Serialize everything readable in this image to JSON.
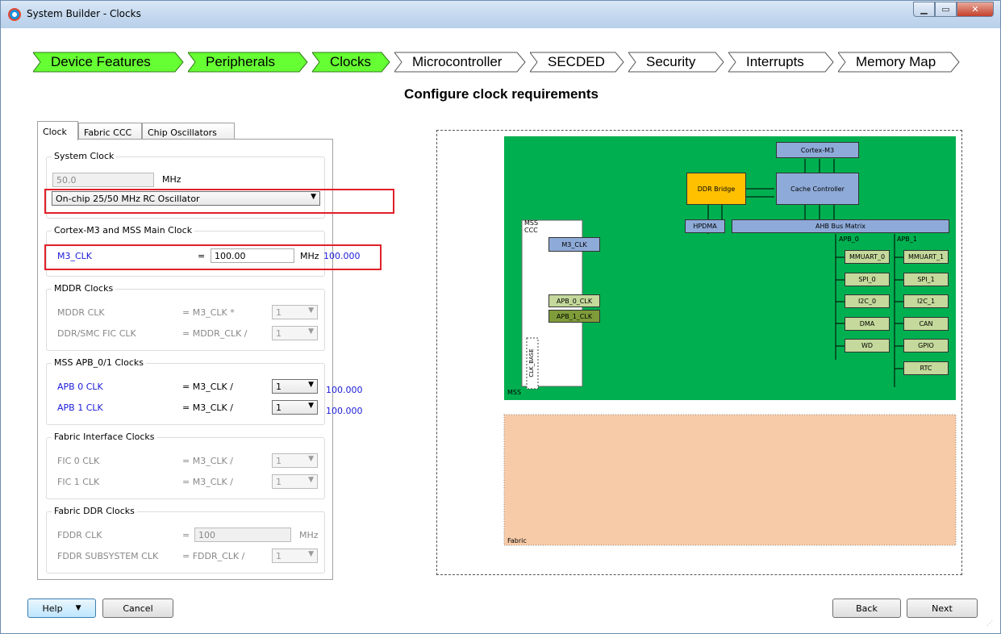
{
  "window": {
    "title": "System Builder - Clocks"
  },
  "steps": [
    {
      "label": "Device Features",
      "state": "done"
    },
    {
      "label": "Peripherals",
      "state": "done"
    },
    {
      "label": "Clocks",
      "state": "current"
    },
    {
      "label": "Microcontroller",
      "state": "todo"
    },
    {
      "label": "SECDED",
      "state": "todo"
    },
    {
      "label": "Security",
      "state": "todo"
    },
    {
      "label": "Interrupts",
      "state": "todo"
    },
    {
      "label": "Memory Map",
      "state": "todo"
    }
  ],
  "heading": "Configure clock requirements",
  "tabs": [
    "Clock",
    "Fabric CCC",
    "Chip Oscillators"
  ],
  "system_clock": {
    "group_label": "System Clock",
    "freq_value": "50.0",
    "unit": "MHz",
    "source": "On-chip 25/50 MHz RC Oscillator"
  },
  "main_clock": {
    "group_label": "Cortex-M3 and MSS Main Clock",
    "name": "M3_CLK",
    "equals": "=",
    "value": "100.00",
    "unit": "MHz",
    "actual": "100.000"
  },
  "mddr": {
    "group_label": "MDDR Clocks",
    "rows": [
      {
        "name": "MDDR  CLK",
        "formula": "= M3_CLK *",
        "ratio": "1"
      },
      {
        "name": "DDR/SMC  FIC  CLK",
        "formula": "= MDDR_CLK /",
        "ratio": "1"
      }
    ]
  },
  "apb": {
    "group_label": "MSS APB_0/1 Clocks",
    "rows": [
      {
        "name": "APB  0  CLK",
        "formula": "= M3_CLK /",
        "ratio": "1",
        "actual": "100.000"
      },
      {
        "name": "APB  1  CLK",
        "formula": "= M3_CLK /",
        "ratio": "1",
        "actual": "100.000"
      }
    ]
  },
  "fic": {
    "group_label": "Fabric Interface Clocks",
    "rows": [
      {
        "name": "FIC  0  CLK",
        "formula": "= M3_CLK /",
        "ratio": "1"
      },
      {
        "name": "FIC  1  CLK",
        "formula": "= M3_CLK /",
        "ratio": "1"
      }
    ]
  },
  "fddr": {
    "group_label": "Fabric DDR Clocks",
    "clk_name": "FDDR  CLK",
    "clk_equals": "=",
    "clk_value": "100",
    "clk_unit": "MHz",
    "sub_name": "FDDR  SUBSYSTEM  CLK",
    "sub_formula": "= FDDR_CLK /",
    "sub_ratio": "1"
  },
  "diagram": {
    "cortex": "Cortex-M3",
    "ddr_bridge": "DDR Bridge",
    "cache": "Cache Controller",
    "hpdma": "HPDMA",
    "ahb": "AHB Bus Matrix",
    "mss_ccc": "MSS  CCC",
    "m3clk": "M3_CLK",
    "apb0clk": "APB_0_CLK",
    "apb1clk": "APB_1_CLK",
    "clkbase": "CLK_BASE",
    "apb0": "APB_0",
    "apb1": "APB_1",
    "left_col": [
      "MMUART_0",
      "SPI_0",
      "I2C_0",
      "DMA",
      "WD"
    ],
    "right_col": [
      "MMUART_1",
      "SPI_1",
      "I2C_1",
      "CAN",
      "GPIO",
      "RTC"
    ],
    "mss_label": "MSS",
    "fabric_label": "Fabric",
    "colors": {
      "mss": "#00b050",
      "fabric": "#f8cba8",
      "block": "#8eaad8",
      "ddr": "#ffc000",
      "periph": "#c4d99b",
      "apbclk": "#7f9c3a"
    }
  },
  "buttons": {
    "help": "Help",
    "cancel": "Cancel",
    "back": "Back",
    "next": "Next"
  }
}
